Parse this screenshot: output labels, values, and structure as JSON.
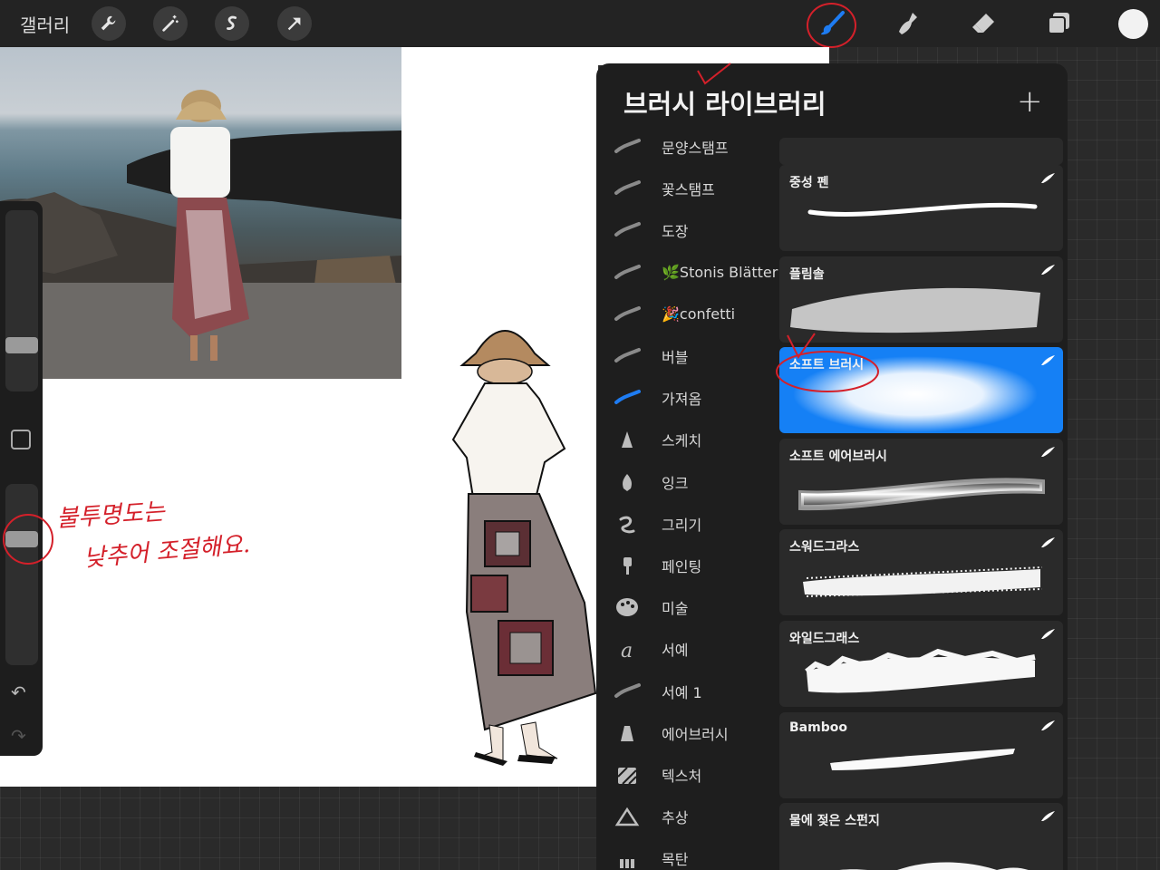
{
  "topbar": {
    "gallery_label": "갤러리",
    "left_tools": [
      "wrench-icon",
      "magic-wand-icon",
      "selection-icon",
      "transform-arrow-icon"
    ],
    "right_tools": [
      "brush-icon",
      "smudge-icon",
      "eraser-icon",
      "layers-icon"
    ],
    "active_tool": "brush",
    "color_swatch": "#f2f2f2",
    "accent": "#1e7cf2"
  },
  "panel": {
    "title": "브러시 라이브러리",
    "add_label": "+",
    "categories": [
      {
        "label": "문양스탬프",
        "icon": "stroke-icon"
      },
      {
        "label": "꽃스탬프",
        "icon": "stroke-icon"
      },
      {
        "label": "도장",
        "icon": "stroke-icon"
      },
      {
        "label": "🌿Stonis Blätter",
        "icon": "stroke-icon"
      },
      {
        "label": "🎉confetti",
        "icon": "stroke-icon"
      },
      {
        "label": "버블",
        "icon": "stroke-icon"
      },
      {
        "label": "가져옴",
        "icon": "stroke-icon",
        "active": true
      },
      {
        "label": "스케치",
        "icon": "pencil-icon"
      },
      {
        "label": "잉크",
        "icon": "pen-nib-icon"
      },
      {
        "label": "그리기",
        "icon": "squiggle-icon"
      },
      {
        "label": "페인팅",
        "icon": "paintbrush-icon"
      },
      {
        "label": "미술",
        "icon": "palette-icon"
      },
      {
        "label": "서예",
        "icon": "calligraphy-icon"
      },
      {
        "label": "서예 1",
        "icon": "stroke-icon"
      },
      {
        "label": "에어브러시",
        "icon": "airbrush-icon"
      },
      {
        "label": "텍스처",
        "icon": "texture-icon"
      },
      {
        "label": "추상",
        "icon": "triangle-icon"
      },
      {
        "label": "목탄",
        "icon": "charcoal-icon"
      }
    ],
    "brushes": [
      {
        "name": ""
      },
      {
        "name": "중성 펜"
      },
      {
        "name": "플림솔"
      },
      {
        "name": "소프트 브러시",
        "selected": true
      },
      {
        "name": "소프트 에어브러시"
      },
      {
        "name": "스워드그라스"
      },
      {
        "name": "와일드그래스"
      },
      {
        "name": "Bamboo"
      },
      {
        "name": "물에 젖은 스펀지"
      }
    ]
  },
  "annotation": {
    "line1": "불투명도는",
    "line2": "낮추어 조절해요."
  }
}
